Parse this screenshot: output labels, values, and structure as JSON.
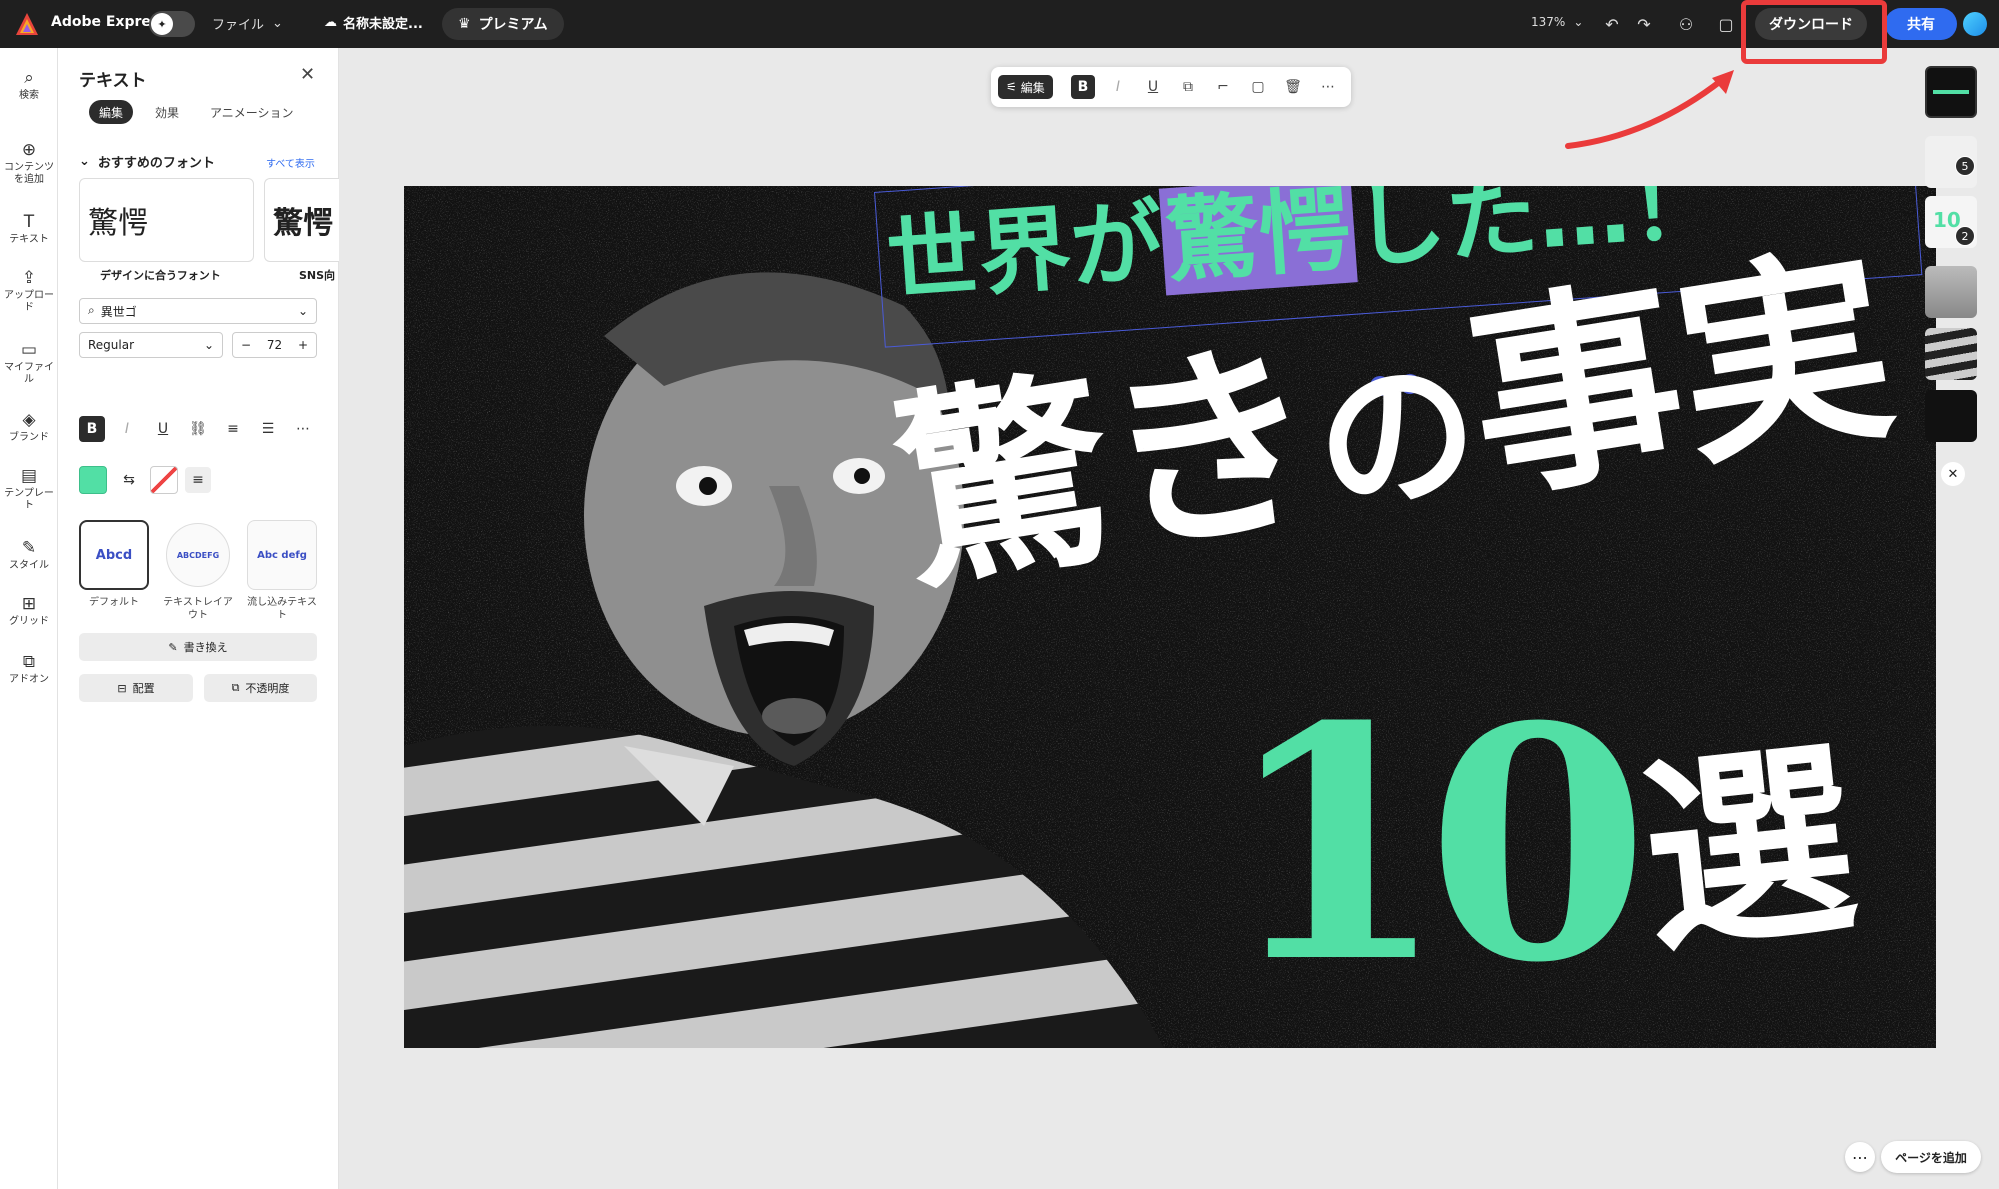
{
  "app": {
    "name": "Adobe Express",
    "file_menu": "ファイル",
    "doc_name": "名称未設定...",
    "premium": "プレミアム",
    "zoom": "137%",
    "download": "ダウンロード",
    "share": "共有"
  },
  "leftrail": [
    {
      "label": "検索",
      "icon": "search-icon",
      "glyph": "⌕"
    },
    {
      "label": "コンテンツを追加",
      "icon": "plus-circle-icon",
      "glyph": "⊕"
    },
    {
      "label": "テキスト",
      "icon": "text-icon",
      "glyph": "T"
    },
    {
      "label": "アップロード",
      "icon": "upload-icon",
      "glyph": "⇪"
    },
    {
      "label": "マイファイル",
      "icon": "folder-icon",
      "glyph": "▭"
    },
    {
      "label": "ブランド",
      "icon": "brand-icon",
      "glyph": "◈"
    },
    {
      "label": "テンプレート",
      "icon": "template-icon",
      "glyph": "▤"
    },
    {
      "label": "スタイル",
      "icon": "style-icon",
      "glyph": "✎"
    },
    {
      "label": "グリッド",
      "icon": "grid-icon",
      "glyph": "⊞"
    },
    {
      "label": "アドオン",
      "icon": "addon-icon",
      "glyph": "⧉"
    }
  ],
  "panel": {
    "title": "テキスト",
    "tabs": [
      "編集",
      "効果",
      "アニメーション"
    ],
    "recommended_title": "おすすめのフォント",
    "show_all": "すべて表示",
    "font_samples": [
      "驚愕",
      "驚愕"
    ],
    "font_captions": [
      "デザインに合うフォント",
      "SNS向"
    ],
    "font_search": "異世ゴ",
    "weight": "Regular",
    "size": "72",
    "text_styles": [
      {
        "label": "デフォルト",
        "preview": "Abcd"
      },
      {
        "label": "テキストレイアウト",
        "preview": "ABCDEFG"
      },
      {
        "label": "流し込みテキスト",
        "preview": "Abc defg"
      }
    ],
    "rewrite": "書き換え",
    "arrange": "配置",
    "opacity": "不透明度"
  },
  "floatbar": {
    "edit": "編集"
  },
  "canvas": {
    "line1a": "世界が",
    "line1b": "驚愕",
    "line1c": "した…！",
    "line2a": "驚き",
    "line2b": "の",
    "line2c": "事実",
    "number": "10",
    "sen": "選",
    "accent_color": "#52dfa5",
    "highlight_color": "#8a6fd6"
  },
  "pages": [
    {
      "badge": ""
    },
    {
      "badge": "5"
    },
    {
      "badge": "2"
    },
    {
      "badge": ""
    },
    {
      "badge": ""
    },
    {
      "badge": ""
    }
  ],
  "bottom": {
    "add_page": "ページを追加"
  }
}
